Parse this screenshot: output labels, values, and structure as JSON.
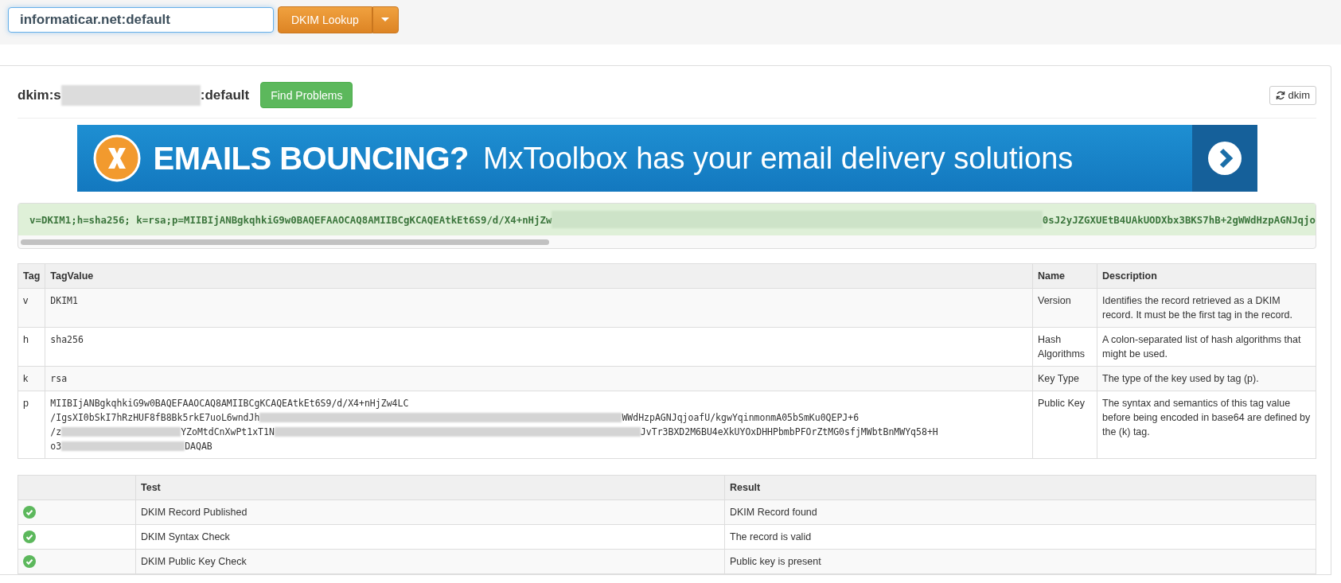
{
  "lookup": {
    "value": "informaticar.net:default",
    "button": "DKIM Lookup"
  },
  "record_header": {
    "parts": [
      "dkim:s",
      ":default"
    ],
    "find_button": "Find Problems",
    "refresh_button": "dkim"
  },
  "banner": {
    "headline": "EMAILS BOUNCING?",
    "tagline": "MxToolbox has your email delivery solutions"
  },
  "record": {
    "parts": [
      "v=DKIM1;h=sha256; k=rsa;p=MIIBIjANBgkqhkiG9w0BAQEFAAOCAQ8AMIIBCgKCAQEAtkEt6S9/d/X4+nHjZw",
      "0sJ2yJZGXUEtB4UAkUODXbx3BKS7hB+2gWWdHzpAGNJqjo"
    ]
  },
  "tags_table": {
    "columns": [
      "Tag",
      "TagValue",
      "Name",
      "Description"
    ],
    "rows": [
      {
        "tag": "v",
        "value": [
          {
            "parts": [
              "DKIM1"
            ]
          }
        ],
        "name": "Version",
        "description": "Identifies the record retrieved as a DKIM record. It must be the first tag in the record."
      },
      {
        "tag": "h",
        "value": [
          {
            "parts": [
              "sha256"
            ]
          }
        ],
        "name": "Hash Algorithms",
        "description": "A colon-separated list of hash algorithms that might be used."
      },
      {
        "tag": "k",
        "value": [
          {
            "parts": [
              "rsa"
            ]
          }
        ],
        "name": "Key Type",
        "description": "The type of the key used by tag (p)."
      },
      {
        "tag": "p",
        "value": [
          {
            "parts": [
              "MIIBIjANBgkqhkiG9w0BAQEFAAOCAQ8AMIIBCgKCAQEAtkEt6S9/d/X4+nHjZw4LC"
            ]
          },
          {
            "parts": [
              "/IgsXI0bSkI7hRzHUF8fB8Bk5rkE7uoL6wndJh",
              "WWdHzpAGNJqjoafU/kgwYqinmonmA05bSmKu0QEPJ+6"
            ]
          },
          {
            "parts": [
              "/z",
              "YZoMtdCnXwPt1xT1N",
              "JvTr3BXD2M6BU4eXkUYOxDHHPbmbPFOrZtMG0sfjMWbtBnMWYq58+H"
            ]
          },
          {
            "parts": [
              "o3",
              "DAQAB"
            ]
          }
        ],
        "name": "Public Key",
        "description": "The syntax and semantics of this tag value before being encoded in base64 are defined by the (k) tag."
      }
    ]
  },
  "tests_table": {
    "columns": [
      "Test",
      "Result"
    ],
    "rows": [
      {
        "passed": true,
        "test": "DKIM Record Published",
        "result": "DKIM Record found"
      },
      {
        "passed": true,
        "test": "DKIM Syntax Check",
        "result": "The record is valid"
      },
      {
        "passed": true,
        "test": "DKIM Public Key Check",
        "result": "Public key is present"
      }
    ]
  }
}
